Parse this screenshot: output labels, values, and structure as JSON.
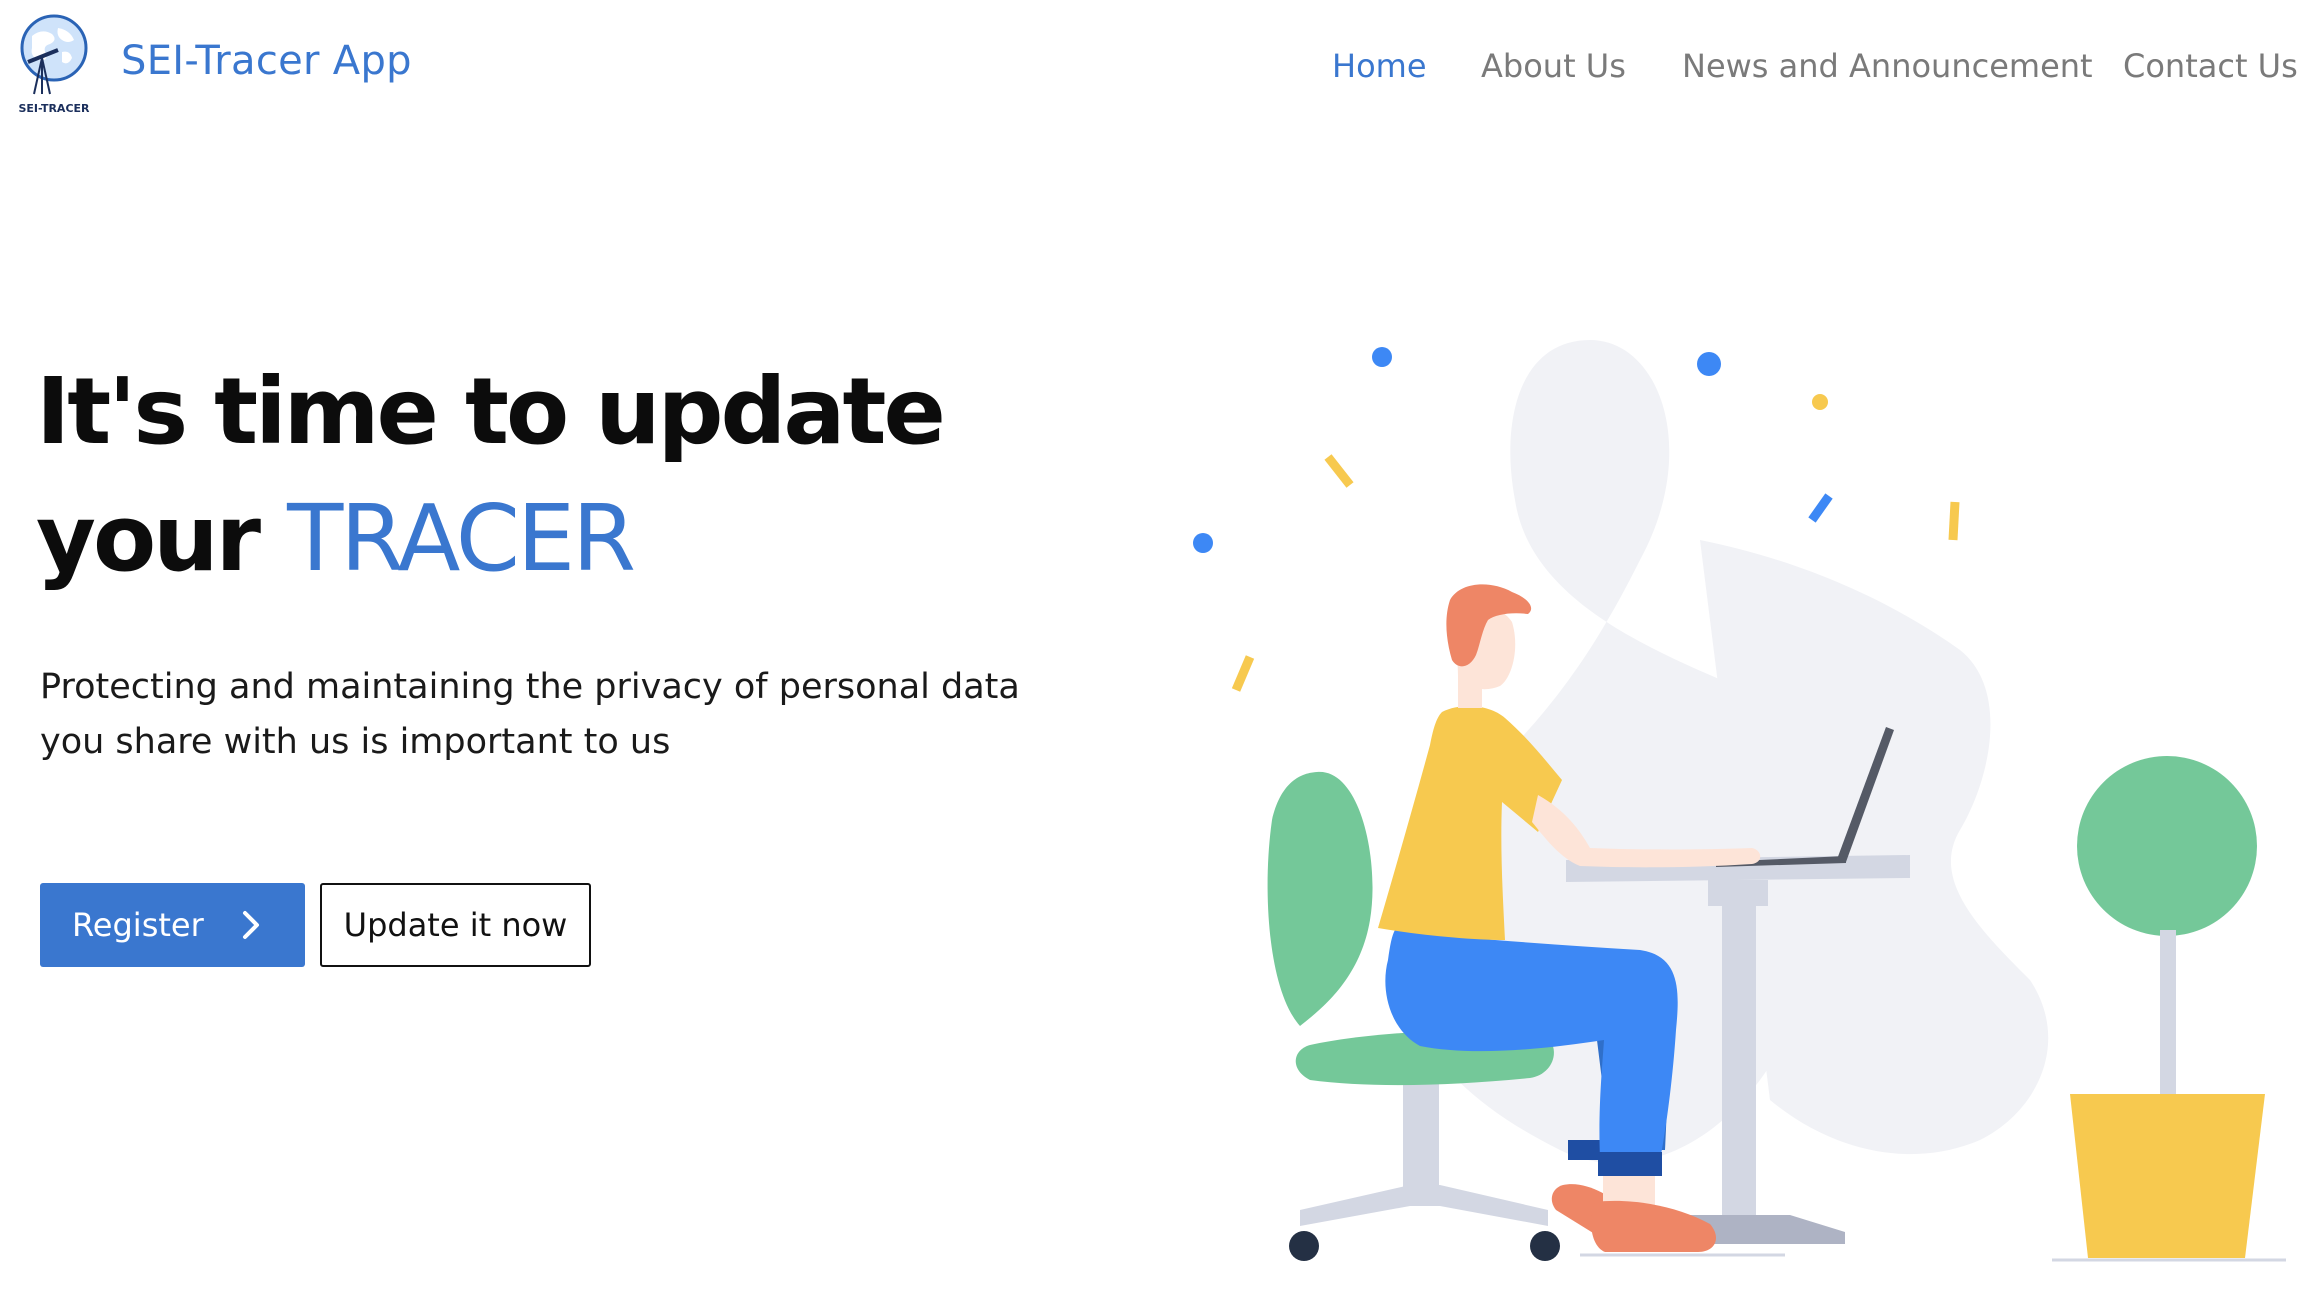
{
  "brand": {
    "name": "SEI-Tracer App",
    "logo_text": "SEI-TRACER"
  },
  "nav": {
    "items": [
      {
        "label": "Home",
        "active": true
      },
      {
        "label": "About Us",
        "active": false
      },
      {
        "label": "News and Announcement",
        "active": false
      },
      {
        "label": "Contact Us",
        "active": false
      }
    ]
  },
  "hero": {
    "title_line1": "It's time to update",
    "title_line2_prefix": "your ",
    "title_line2_accent": "TRACER",
    "subtitle_line1": "Protecting and maintaining the privacy of personal data",
    "subtitle_line2": "you share with us is important to us"
  },
  "buttons": {
    "register_label": "Register",
    "update_label": "Update it now"
  },
  "colors": {
    "accent": "#3a77cf",
    "yellow": "#f7c94f",
    "green": "#74c899",
    "pants_blue": "#3d88f5",
    "hair": "#ee8666"
  },
  "icons": {
    "register_icon": "chevron-right-icon",
    "logo_icon": "globe-telescope-icon"
  }
}
